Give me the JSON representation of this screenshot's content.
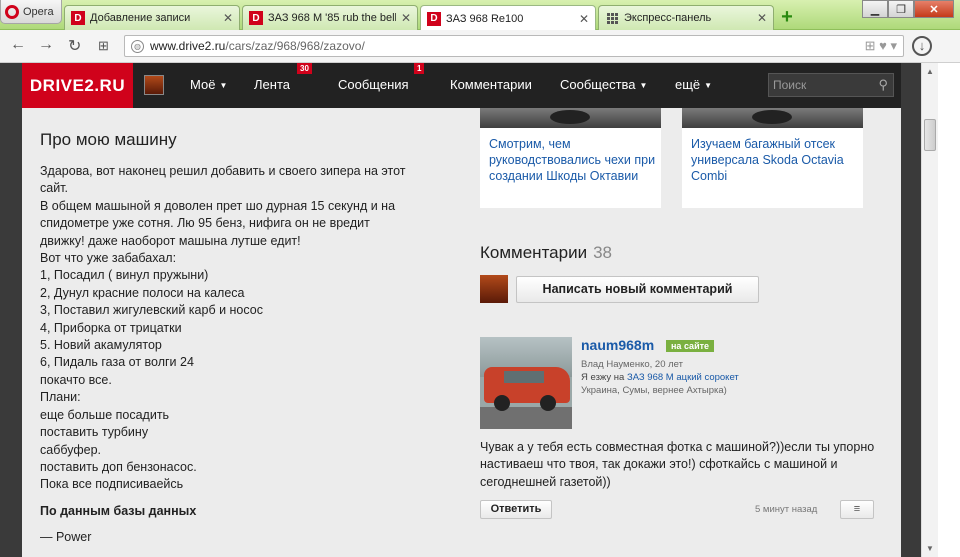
{
  "browser": {
    "menu_label": "Opera",
    "tabs": [
      {
        "title": "Добавление записи",
        "fav": "D"
      },
      {
        "title": "ЗАЗ 968 М '85 rub the bell",
        "fav": "D"
      },
      {
        "title": "ЗАЗ 968 Re100",
        "fav": "D"
      },
      {
        "title": "Экспресс-панель",
        "fav": ""
      }
    ],
    "new_tab": "+",
    "url_host": "www.drive2.ru",
    "url_path": "/cars/zaz/968/968/zazovo/"
  },
  "header": {
    "logo": "DRIVE2.RU",
    "menu": {
      "moe": "Моё",
      "lenta": "Лента",
      "lenta_badge": "30",
      "messages": "Сообщения",
      "messages_badge": "1",
      "comments": "Комментарии",
      "communities": "Сообщества",
      "more": "ещё"
    },
    "search_placeholder": "Поиск"
  },
  "about": {
    "title": "Про мою машину",
    "lines": [
      "Здарова, вот наконец решил добавить и своего зипера на этот",
      "сайт.",
      "В общем машыной я доволен прет шо дурная 15 секунд и на",
      "спидометре уже сотня. Лю 95 бенз, нифига он не вредит",
      "движку! даже наоборот машына лутше едит!",
      "Вот что уже забабахал:",
      "1, Посадил ( винул пружыни)",
      "2, Дунул красние полоси на калеса",
      "3, Поставил жигулевский карб и носос",
      "4, Приборка от трицатки",
      "5. Новий акамулятор",
      "6, Пидаль газа от волги 24",
      "покачто все.",
      "Плани:",
      "еще больше посадить",
      "поставить турбину",
      "саббуфер.",
      "поставить доп бензонасос.",
      "Пока все подписиваейсь"
    ],
    "db_title": "По данным базы данных",
    "db_item": "—  Power"
  },
  "cards": [
    {
      "text": "Смотрим, чем руководствовались чехи при создании Шкоды Октавии"
    },
    {
      "text": "Изучаем багажный отсек универсала Skoda Octavia Combi"
    }
  ],
  "comments": {
    "title": "Комментарии",
    "count": "38",
    "write_button": "Написать новый комментарий",
    "item": {
      "username": "naum968m",
      "online": "на сайте",
      "realname": "Влад Науменко, 20 лет",
      "drive_prefix": "Я езжу на",
      "drive_link": "ЗАЗ 968 М ацкий сорокет",
      "location": "Украина, Сумы, вернее Ахтырка)",
      "text": "Чувак а у тебя есть совместная фотка с машиной?))если ты упорно настиваеш что твоя, так докажи это!) сфоткайсь с машиной и сегоднешней газетой))",
      "reply": "Ответить",
      "time": "5 минут назад",
      "more": "≡"
    }
  },
  "colors": {
    "brand_red": "#d0021b",
    "link": "#1a5aa8",
    "online": "#7ab040",
    "header_bg": "#222222"
  }
}
